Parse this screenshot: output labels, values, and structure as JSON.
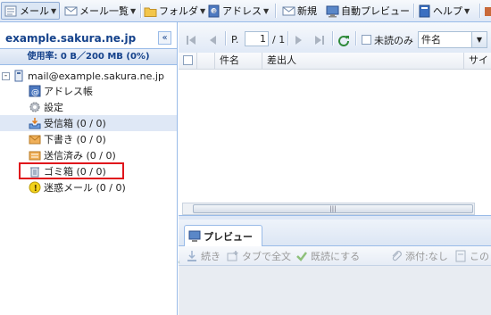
{
  "toolbar": {
    "mail": "メール",
    "mail_list": "メール一覧",
    "folder": "フォルダ",
    "address": "アドレス",
    "new": "新規",
    "auto_preview": "自動プレビュー",
    "help": "ヘルプ"
  },
  "sidebar": {
    "account": "example.sakura.ne.jp",
    "usage": "使用率: 0 B／200 MB (0%)",
    "root": "mail@example.sakura.ne.jp",
    "items": [
      {
        "label": "アドレス帳",
        "icon": "address-book-icon"
      },
      {
        "label": "設定",
        "icon": "settings-gear-icon"
      },
      {
        "label": "受信箱 (0 / 0)",
        "icon": "inbox-icon"
      },
      {
        "label": "下書き (0 / 0)",
        "icon": "drafts-icon"
      },
      {
        "label": "送信済み (0 / 0)",
        "icon": "sent-icon"
      },
      {
        "label": "ゴミ箱 (0 / 0)",
        "icon": "trash-icon"
      },
      {
        "label": "迷惑メール (0 / 0)",
        "icon": "spam-icon"
      }
    ]
  },
  "pager": {
    "page_label": "P.",
    "page_value": "1",
    "page_total": "/ 1",
    "unread_only": "未読のみ",
    "search_field": "件名"
  },
  "grid": {
    "columns": [
      "件名",
      "差出人",
      "サイズ"
    ]
  },
  "preview": {
    "tab": "プレビュー",
    "actions": [
      "続き",
      "タブで全文",
      "既読にする",
      "添付:なし",
      "この"
    ]
  },
  "colors": {
    "border": "#99bbe8",
    "header_text": "#15428b",
    "highlight": "#e0151c",
    "selected_row": "#dfe8f6"
  }
}
